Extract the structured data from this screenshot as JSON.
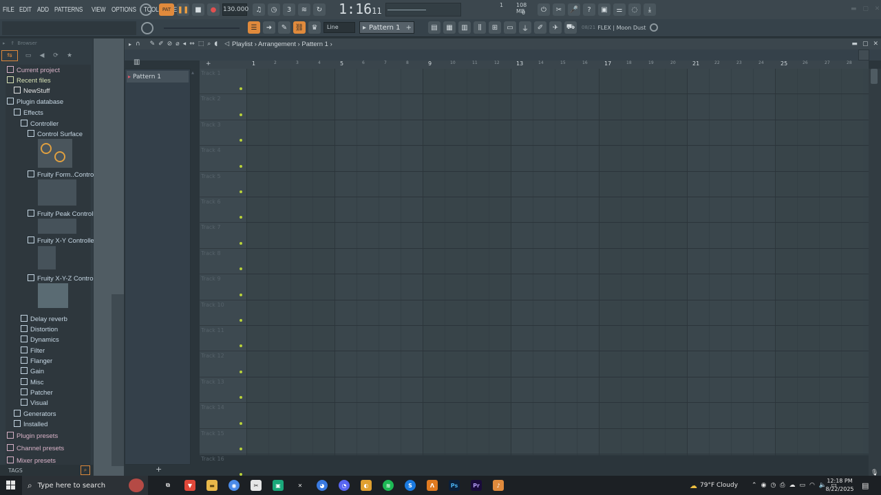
{
  "menu": [
    "FILE",
    "EDIT",
    "ADD",
    "PATTERNS",
    "VIEW",
    "OPTIONS",
    "TOOLS",
    "HELP"
  ],
  "transport": {
    "pat_label": "PAT",
    "tempo": "130.000",
    "time": "1:16",
    "time_ticks": "11",
    "time_small": "M:S:CS"
  },
  "meters": {
    "memory": "108 MB",
    "cpu_top": "1",
    "cpu_bottom": "0"
  },
  "toolbar2": {
    "snap": "Line",
    "pattern": "Pattern 1",
    "plugin_counter": "08/21",
    "plugin_name": "FLEX | Moon Dust"
  },
  "browser": {
    "title": "Browser",
    "tree": [
      {
        "label": "Current project",
        "indent": 0,
        "color": "#d9b3c8"
      },
      {
        "label": "Recent files",
        "indent": 0,
        "color": "#d7e2b5"
      },
      {
        "label": "NewStuff",
        "indent": 1,
        "color": "#e3e3e3"
      },
      {
        "label": "Plugin database",
        "indent": 0,
        "color": "#c6d7e4"
      },
      {
        "label": "Effects",
        "indent": 1,
        "color": "#c6d7e4"
      },
      {
        "label": "Controller",
        "indent": 2,
        "color": "#c6d7e4"
      },
      {
        "label": "Control Surface",
        "indent": 3,
        "color": "#c6d7e4"
      },
      {
        "label": "Fruity Form..Controller",
        "indent": 3,
        "color": "#c6d7e4"
      },
      {
        "label": "Fruity Peak Controller",
        "indent": 3,
        "color": "#c6d7e4"
      },
      {
        "label": "Fruity X-Y Controller",
        "indent": 3,
        "color": "#c6d7e4"
      },
      {
        "label": "Fruity X-Y-Z Controller",
        "indent": 3,
        "color": "#c6d7e4"
      },
      {
        "label": "Delay reverb",
        "indent": 2,
        "color": "#c6d7e4"
      },
      {
        "label": "Distortion",
        "indent": 2,
        "color": "#c6d7e4"
      },
      {
        "label": "Dynamics",
        "indent": 2,
        "color": "#c6d7e4"
      },
      {
        "label": "Filter",
        "indent": 2,
        "color": "#c6d7e4"
      },
      {
        "label": "Flanger",
        "indent": 2,
        "color": "#c6d7e4"
      },
      {
        "label": "Gain",
        "indent": 2,
        "color": "#c6d7e4"
      },
      {
        "label": "Misc",
        "indent": 2,
        "color": "#c6d7e4"
      },
      {
        "label": "Patcher",
        "indent": 2,
        "color": "#c6d7e4"
      },
      {
        "label": "Visual",
        "indent": 2,
        "color": "#c6d7e4"
      },
      {
        "label": "Generators",
        "indent": 1,
        "color": "#c6d7e4"
      },
      {
        "label": "Installed",
        "indent": 1,
        "color": "#c6d7e4"
      },
      {
        "label": "Plugin presets",
        "indent": 0,
        "color": "#d9b3c8"
      },
      {
        "label": "Channel presets",
        "indent": 0,
        "color": "#d9b3c8"
      },
      {
        "label": "Mixer presets",
        "indent": 0,
        "color": "#d9b3c8"
      }
    ],
    "tags_label": "TAGS"
  },
  "playlist": {
    "breadcrumb": [
      "Playlist",
      "Arrangement",
      "Pattern 1"
    ],
    "pattern_item": "Pattern 1",
    "tracks": [
      "Track 1",
      "Track 2",
      "Track 3",
      "Track 4",
      "Track 5",
      "Track 6",
      "Track 7",
      "Track 8",
      "Track 9",
      "Track 10",
      "Track 11",
      "Track 12",
      "Track 13",
      "Track 14",
      "Track 15",
      "Track 16"
    ],
    "bars": [
      "1",
      "2",
      "3",
      "4",
      "5",
      "6",
      "7",
      "8",
      "9",
      "10",
      "11",
      "12",
      "13",
      "14",
      "15",
      "16",
      "17",
      "18",
      "19",
      "20",
      "21",
      "22",
      "23",
      "24",
      "25",
      "26",
      "27",
      "28"
    ]
  },
  "taskbar": {
    "search_placeholder": "Type here to search",
    "weather": "79°F  Cloudy",
    "time": "12:18 PM",
    "date": "8/22/2025"
  }
}
